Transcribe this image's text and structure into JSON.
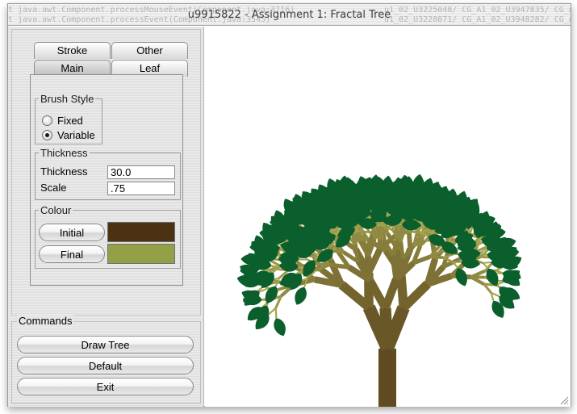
{
  "window": {
    "title": "u9915822 - Assignment 1: Fractal Tree",
    "ghost_text": [
      "at java.awt.Component.processMouseEvent(Component.java:3716)",
      "at java.awt.Component.processEvent(Component.java:3545)",
      "u1_02_U3225048/ CG_A1_02_U3947835/ CG_A",
      "u1_02_U3228871/ CG_A1_02_U3948282/ CG_A"
    ]
  },
  "tabs": {
    "row1": [
      "Stroke",
      "Other"
    ],
    "row2": [
      "Main",
      "Leaf"
    ],
    "selected": "Main"
  },
  "brush_style": {
    "legend": "Brush Style",
    "options": [
      "Fixed",
      "Variable"
    ],
    "selected": "Variable"
  },
  "thickness": {
    "legend": "Thickness",
    "thickness_label": "Thickness",
    "thickness_value": "30.0",
    "scale_label": "Scale",
    "scale_value": ".75"
  },
  "colour": {
    "legend": "Colour",
    "initial_label": "Initial",
    "final_label": "Final",
    "initial_color": "#4c3112",
    "final_color": "#93a046"
  },
  "commands": {
    "legend": "Commands",
    "draw_label": "Draw Tree",
    "default_label": "Default",
    "exit_label": "Exit"
  },
  "colors": {
    "trunk": "#5f4a21",
    "branch_light": "#a5a44f",
    "leaf": "#0b5f2c"
  },
  "icons": [
    "resize-grip-icon"
  ]
}
